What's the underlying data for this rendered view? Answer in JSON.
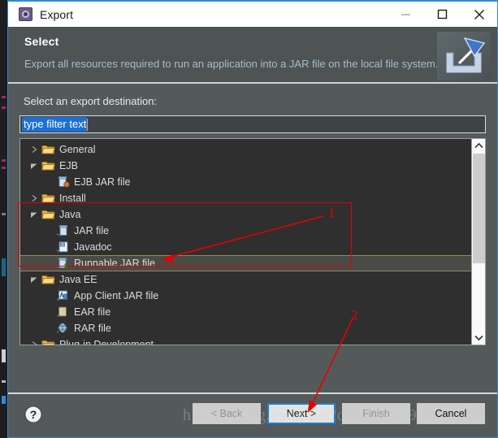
{
  "window": {
    "title": "Export",
    "icon": "export-gear-icon",
    "controls": {
      "minimize": "minimize-icon",
      "maximize": "maximize-icon",
      "close": "close-icon"
    }
  },
  "header": {
    "title": "Select",
    "description": "Export all resources required to run an application into a JAR file on the local file system.",
    "icon": "export-banner-icon"
  },
  "main": {
    "destination_label": "Select an export destination:",
    "filter": {
      "value": "type filter text",
      "placeholder": "type filter text",
      "selected": true
    },
    "tree": [
      {
        "label": "General",
        "level": 1,
        "icon": "folder-icon",
        "twisty": "collapsed",
        "selected": false
      },
      {
        "label": "EJB",
        "level": 1,
        "icon": "folder-icon",
        "twisty": "expanded",
        "selected": false
      },
      {
        "label": "EJB JAR file",
        "level": 2,
        "icon": "ejb-jar-file-icon",
        "twisty": "none",
        "selected": false
      },
      {
        "label": "Install",
        "level": 1,
        "icon": "folder-icon",
        "twisty": "collapsed",
        "selected": false
      },
      {
        "label": "Java",
        "level": 1,
        "icon": "folder-icon",
        "twisty": "expanded",
        "selected": false
      },
      {
        "label": "JAR file",
        "level": 2,
        "icon": "jar-file-icon",
        "twisty": "none",
        "selected": false
      },
      {
        "label": "Javadoc",
        "level": 2,
        "icon": "javadoc-icon",
        "twisty": "none",
        "selected": false
      },
      {
        "label": "Runnable JAR file",
        "level": 2,
        "icon": "runnable-jar-icon",
        "twisty": "none",
        "selected": true
      },
      {
        "label": "Java EE",
        "level": 1,
        "icon": "folder-icon",
        "twisty": "expanded",
        "selected": false
      },
      {
        "label": "App Client JAR file",
        "level": 2,
        "icon": "app-client-jar-icon",
        "twisty": "none",
        "selected": false
      },
      {
        "label": "EAR file",
        "level": 2,
        "icon": "ear-file-icon",
        "twisty": "none",
        "selected": false
      },
      {
        "label": "RAR file",
        "level": 2,
        "icon": "rar-file-icon",
        "twisty": "none",
        "selected": false
      },
      {
        "label": "Plug-in Development",
        "level": 1,
        "icon": "folder-icon",
        "twisty": "collapsed",
        "selected": false
      }
    ],
    "scrollbar": {
      "up": "chevron-up-icon",
      "down": "chevron-down-icon"
    }
  },
  "footer": {
    "help": "help-icon",
    "buttons": [
      {
        "label": "< Back",
        "state": "disabled"
      },
      {
        "label": "Next >",
        "state": "focused"
      },
      {
        "label": "Finish",
        "state": "disabled"
      },
      {
        "label": "Cancel",
        "state": "enabled"
      }
    ]
  },
  "annotations": {
    "marker_1": "1",
    "marker_2": "2",
    "color": "#e60000"
  },
  "watermark": "https://blog.csdn.net/qq_21808961"
}
